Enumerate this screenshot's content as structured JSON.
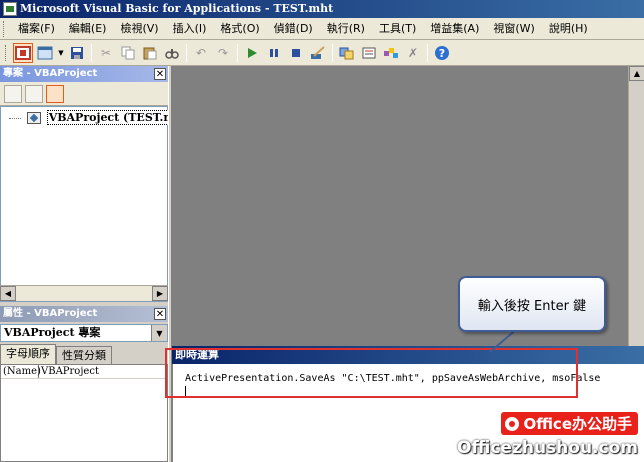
{
  "window": {
    "title": "Microsoft Visual Basic for Applications - TEST.mht"
  },
  "menubar": {
    "items": [
      {
        "label": "檔案(F)"
      },
      {
        "label": "編輯(E)"
      },
      {
        "label": "檢視(V)"
      },
      {
        "label": "插入(I)"
      },
      {
        "label": "格式(O)"
      },
      {
        "label": "偵錯(D)"
      },
      {
        "label": "執行(R)"
      },
      {
        "label": "工具(T)"
      },
      {
        "label": "增益集(A)"
      },
      {
        "label": "視窗(W)"
      },
      {
        "label": "說明(H)"
      }
    ]
  },
  "toolbar": {
    "icons": [
      "view-application-icon",
      "insert-form-icon",
      "save-icon",
      "cut-icon",
      "copy-icon",
      "paste-icon",
      "find-icon",
      "undo-icon",
      "redo-icon",
      "run-icon",
      "break-icon",
      "reset-icon",
      "design-mode-icon",
      "project-explorer-icon",
      "properties-window-icon",
      "object-browser-icon",
      "toolbox-icon",
      "help-icon"
    ]
  },
  "project_panel": {
    "title": "專案 - VBAProject",
    "tree_root_label": "VBAProject (TEST.mht)"
  },
  "properties_panel": {
    "title": "屬性 - VBAProject",
    "object_dropdown": "VBAProject 專案",
    "tabs": [
      "字母順序",
      "性質分類"
    ],
    "rows": [
      {
        "name": "(Name)",
        "value": "VBAProject"
      }
    ]
  },
  "immediate_window": {
    "title": "即時運算",
    "code": "ActivePresentation.SaveAs \"C:\\TEST.mht\", ppSaveAsWebArchive, msoFalse"
  },
  "callout": {
    "text": "輸入後按 Enter 鍵"
  },
  "watermark": {
    "badge": "Office办公助手",
    "url": "Officezhushou.com"
  },
  "colors": {
    "titlebar": "#0a246a",
    "highlight": "#e03030",
    "callout_border": "#3e5c96",
    "watermark_red": "#e8211b"
  }
}
